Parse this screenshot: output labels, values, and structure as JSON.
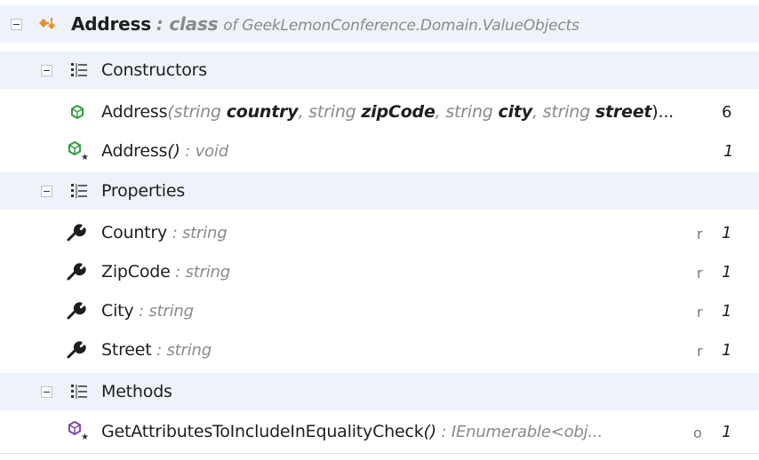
{
  "header": {
    "name": "Address",
    "kind": ": class",
    "of": "of GeekLemonConference.Domain.ValueObjects",
    "icon": "class-icon"
  },
  "groups": {
    "constructors": {
      "label": "Constructors",
      "icon": "members-list-icon"
    },
    "properties": {
      "label": "Properties",
      "icon": "members-list-icon"
    },
    "methods": {
      "label": "Methods",
      "icon": "members-list-icon"
    }
  },
  "constructors": [
    {
      "name": "Address",
      "sig_open": "(string ",
      "p1": "country",
      "s2": ", string ",
      "p2": "zipCode",
      "s3": ", string ",
      "p3": "city",
      "s4": ", string ",
      "p4": "street",
      "sig_close": ")...",
      "count": "6",
      "icon": "constructor-icon"
    },
    {
      "name": "Address",
      "sig": "()",
      "type": " : void",
      "count": "1",
      "icon": "static-constructor-icon"
    }
  ],
  "properties": [
    {
      "name": "Country",
      "type": " : string",
      "flag": "r",
      "count": "1",
      "icon": "wrench-icon"
    },
    {
      "name": "ZipCode",
      "type": " : string",
      "flag": "r",
      "count": "1",
      "icon": "wrench-icon"
    },
    {
      "name": "City",
      "type": " : string",
      "flag": "r",
      "count": "1",
      "icon": "wrench-icon"
    },
    {
      "name": "Street",
      "type": " : string",
      "flag": "r",
      "count": "1",
      "icon": "wrench-icon"
    }
  ],
  "methods": [
    {
      "name": "GetAttributesToIncludeInEqualityCheck",
      "sig": "()",
      "type": " : IEnumerable<obj...",
      "flag": "o",
      "count": "1",
      "icon": "method-icon"
    }
  ],
  "colors": {
    "group_bg": "#eef3fa",
    "constructor_green": "#2e9e3c",
    "method_purple": "#7a4bb0",
    "class_orange": "#e8932a"
  }
}
